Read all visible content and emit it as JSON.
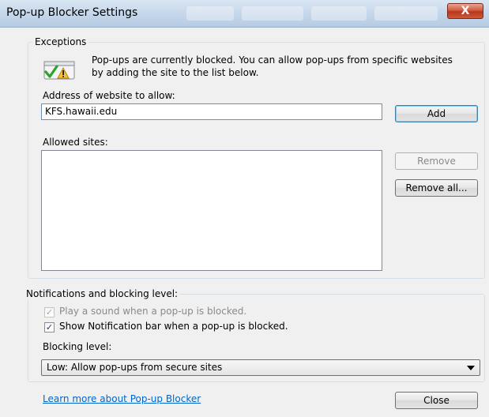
{
  "window": {
    "title": "Pop-up Blocker Settings",
    "close_glyph": "X"
  },
  "exceptions": {
    "group_label": "Exceptions",
    "info_icon": "warning-check-icon",
    "info_text": "Pop-ups are currently blocked.  You can allow pop-ups from specific websites by adding the site to the list below.",
    "address_label": "Address of website to allow:",
    "address_value": "KFS.hawaii.edu",
    "add_button": "Add",
    "allowed_label": "Allowed sites:",
    "allowed_sites": [],
    "remove_button": "Remove",
    "remove_all_button": "Remove all..."
  },
  "notifications": {
    "group_label": "Notifications and blocking level:",
    "play_sound_label": "Play a sound when a pop-up is blocked.",
    "play_sound_checked": true,
    "play_sound_enabled": false,
    "show_bar_label": "Show Notification bar when a pop-up is blocked.",
    "show_bar_checked": true,
    "blocking_level_label": "Blocking level:",
    "blocking_level_value": "Low: Allow pop-ups from secure sites"
  },
  "footer": {
    "learn_more_link": "Learn more about Pop-up Blocker",
    "close_button": "Close"
  },
  "colors": {
    "link": "#0066cc",
    "close_button_red": "#c0392b"
  }
}
